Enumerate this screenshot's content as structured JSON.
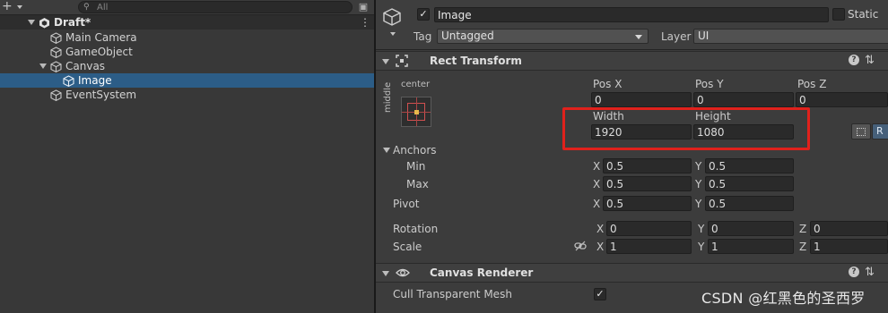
{
  "hierarchy": {
    "search_placeholder": "All",
    "scene_name": "Draft*",
    "items": [
      {
        "label": "Main Camera"
      },
      {
        "label": "GameObject"
      },
      {
        "label": "Canvas"
      },
      {
        "label": "Image"
      },
      {
        "label": "EventSystem"
      }
    ]
  },
  "inspector": {
    "object_name": "Image",
    "static_label": "Static",
    "tag_label": "Tag",
    "tag_value": "Untagged",
    "layer_label": "Layer",
    "layer_value": "UI",
    "rect_transform": {
      "title": "Rect Transform",
      "anchor_h": "center",
      "anchor_v": "middle",
      "pos_x_label": "Pos X",
      "pos_y_label": "Pos Y",
      "pos_z_label": "Pos Z",
      "pos_x": "0",
      "pos_y": "0",
      "pos_z": "0",
      "width_label": "Width",
      "height_label": "Height",
      "width": "1920",
      "height": "1080",
      "raw_button": "R",
      "anchors_label": "Anchors",
      "min_label": "Min",
      "max_label": "Max",
      "anchor_min_x": "0.5",
      "anchor_min_y": "0.5",
      "anchor_max_x": "0.5",
      "anchor_max_y": "0.5",
      "pivot_label": "Pivot",
      "pivot_x": "0.5",
      "pivot_y": "0.5",
      "rotation_label": "Rotation",
      "rotation_x": "0",
      "rotation_y": "0",
      "rotation_z": "0",
      "scale_label": "Scale",
      "scale_x": "1",
      "scale_y": "1",
      "scale_z": "1",
      "axis_x": "X",
      "axis_y": "Y",
      "axis_z": "Z"
    },
    "canvas_renderer": {
      "title": "Canvas Renderer",
      "cull_label": "Cull Transparent Mesh",
      "cull_checked": true
    }
  },
  "watermark": "CSDN @红黑色的圣西罗",
  "icons": {
    "add": "plus-icon",
    "search": "search-icon",
    "lock": "lock-icon",
    "scene": "unity-scene-icon",
    "gameobject": "cube-icon",
    "rect_transform": "rect-transform-icon",
    "canvas_renderer": "eye-icon",
    "help": "help-icon",
    "presets": "presets-icon",
    "link": "link-icon"
  },
  "colors": {
    "selection": "#2c5d87",
    "highlight_box": "#e0211c",
    "panel_bg": "#383838",
    "inspector_bg": "#3c3c3c"
  }
}
